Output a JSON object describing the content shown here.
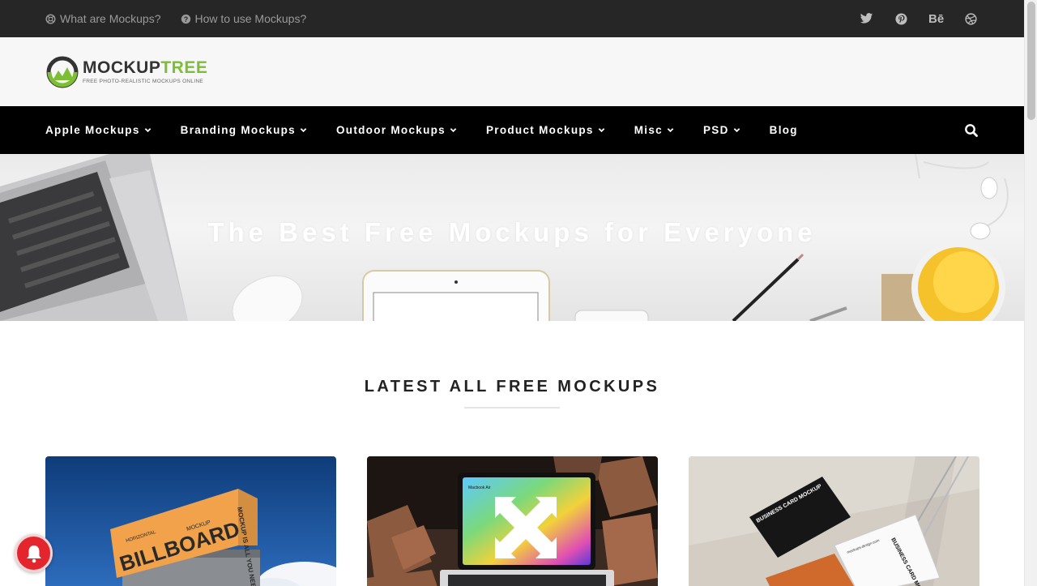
{
  "topbar": {
    "links": [
      {
        "label": "What are Mockups?",
        "icon": "help-ring-icon"
      },
      {
        "label": "How to use Mockups?",
        "icon": "question-circle-icon"
      }
    ],
    "social": [
      {
        "name": "twitter-icon",
        "glyph": ""
      },
      {
        "name": "pinterest-icon",
        "glyph": ""
      },
      {
        "name": "behance-icon",
        "glyph": "Bē"
      },
      {
        "name": "dribbble-icon",
        "glyph": ""
      }
    ]
  },
  "header": {
    "logo_name_a": "MOCKUP",
    "logo_name_b": "TREE",
    "logo_tagline": "FREE PHOTO-REALISTIC MOCKUPS ONLINE"
  },
  "nav": {
    "items": [
      {
        "label": "Apple Mockups",
        "dropdown": true
      },
      {
        "label": "Branding Mockups",
        "dropdown": true
      },
      {
        "label": "Outdoor Mockups",
        "dropdown": true
      },
      {
        "label": "Product Mockups",
        "dropdown": true
      },
      {
        "label": "Misc",
        "dropdown": true
      },
      {
        "label": "PSD",
        "dropdown": true
      },
      {
        "label": "Blog",
        "dropdown": false
      }
    ]
  },
  "hero": {
    "title": "The Best Free Mockups for Everyone"
  },
  "latest": {
    "title": "LATEST ALL FREE MOCKUPS"
  },
  "cards": [
    {
      "billboard_text": "BILLBOARD",
      "billboard_sub": "MOCKUP",
      "side_text": "MOCKUP IS ALL YOU NEED",
      "small_text": "HORIZONTAL"
    },
    {
      "screen_text": "Macbook Air"
    },
    {
      "card_text_a": "BUSINESS CARD MOCKUP",
      "card_text_b": "BUSINESS CARD MOCKUP",
      "card_site": "mockups-design.com"
    }
  ],
  "colors": {
    "topbar_bg": "#262626",
    "nav_bg": "#000000",
    "accent_green": "#7cbf34",
    "bell_red": "#e3262e"
  }
}
